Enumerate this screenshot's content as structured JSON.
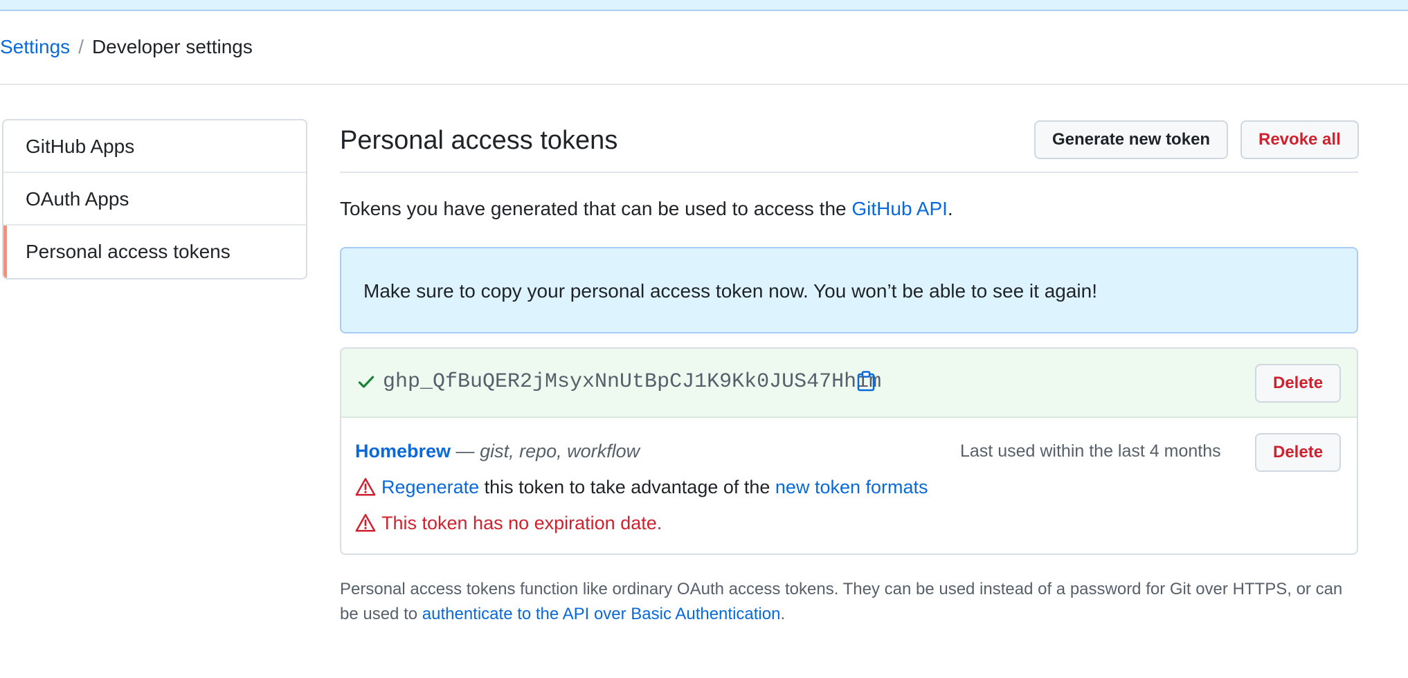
{
  "breadcrumb": {
    "parent": "Settings",
    "separator": "/",
    "current": "Developer settings"
  },
  "sidebar": {
    "items": [
      {
        "label": "GitHub Apps"
      },
      {
        "label": "OAuth Apps"
      },
      {
        "label": "Personal access tokens",
        "selected": true
      }
    ]
  },
  "main": {
    "title": "Personal access tokens",
    "generate_button": "Generate new token",
    "revoke_button": "Revoke all",
    "intro_text": "Tokens you have generated that can be used to access the ",
    "intro_link": "GitHub API",
    "intro_end": ".",
    "flash_message": "Make sure to copy your personal access token now. You won’t be able to see it again!",
    "new_token": {
      "value": "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",
      "delete_label": "Delete"
    },
    "existing_token": {
      "name": "Homebrew",
      "separator": " — ",
      "scopes": "gist, repo, workflow",
      "last_used": "Last used within the last 4 months",
      "delete_label": "Delete",
      "warning_regenerate_link": "Regenerate",
      "warning_regenerate_text": " this token to take advantage of the ",
      "warning_formats_link": "new token formats",
      "warning_expiration": "This token has no expiration date."
    },
    "footer": {
      "text_1": "Personal access tokens function like ordinary OAuth access tokens. They can be used instead of a password for Git over HTTPS, or can be used to ",
      "link": "authenticate to the API over Basic Authentication",
      "text_2": "."
    }
  },
  "colors": {
    "link": "#0969da",
    "danger": "#cf222e",
    "success": "#1a7f37",
    "flash_bg": "#ddf4ff",
    "selected_marker": "#fd8c73"
  },
  "icons": {
    "check": "check-icon",
    "copy": "clipboard-icon",
    "alert": "alert-triangle-icon"
  }
}
